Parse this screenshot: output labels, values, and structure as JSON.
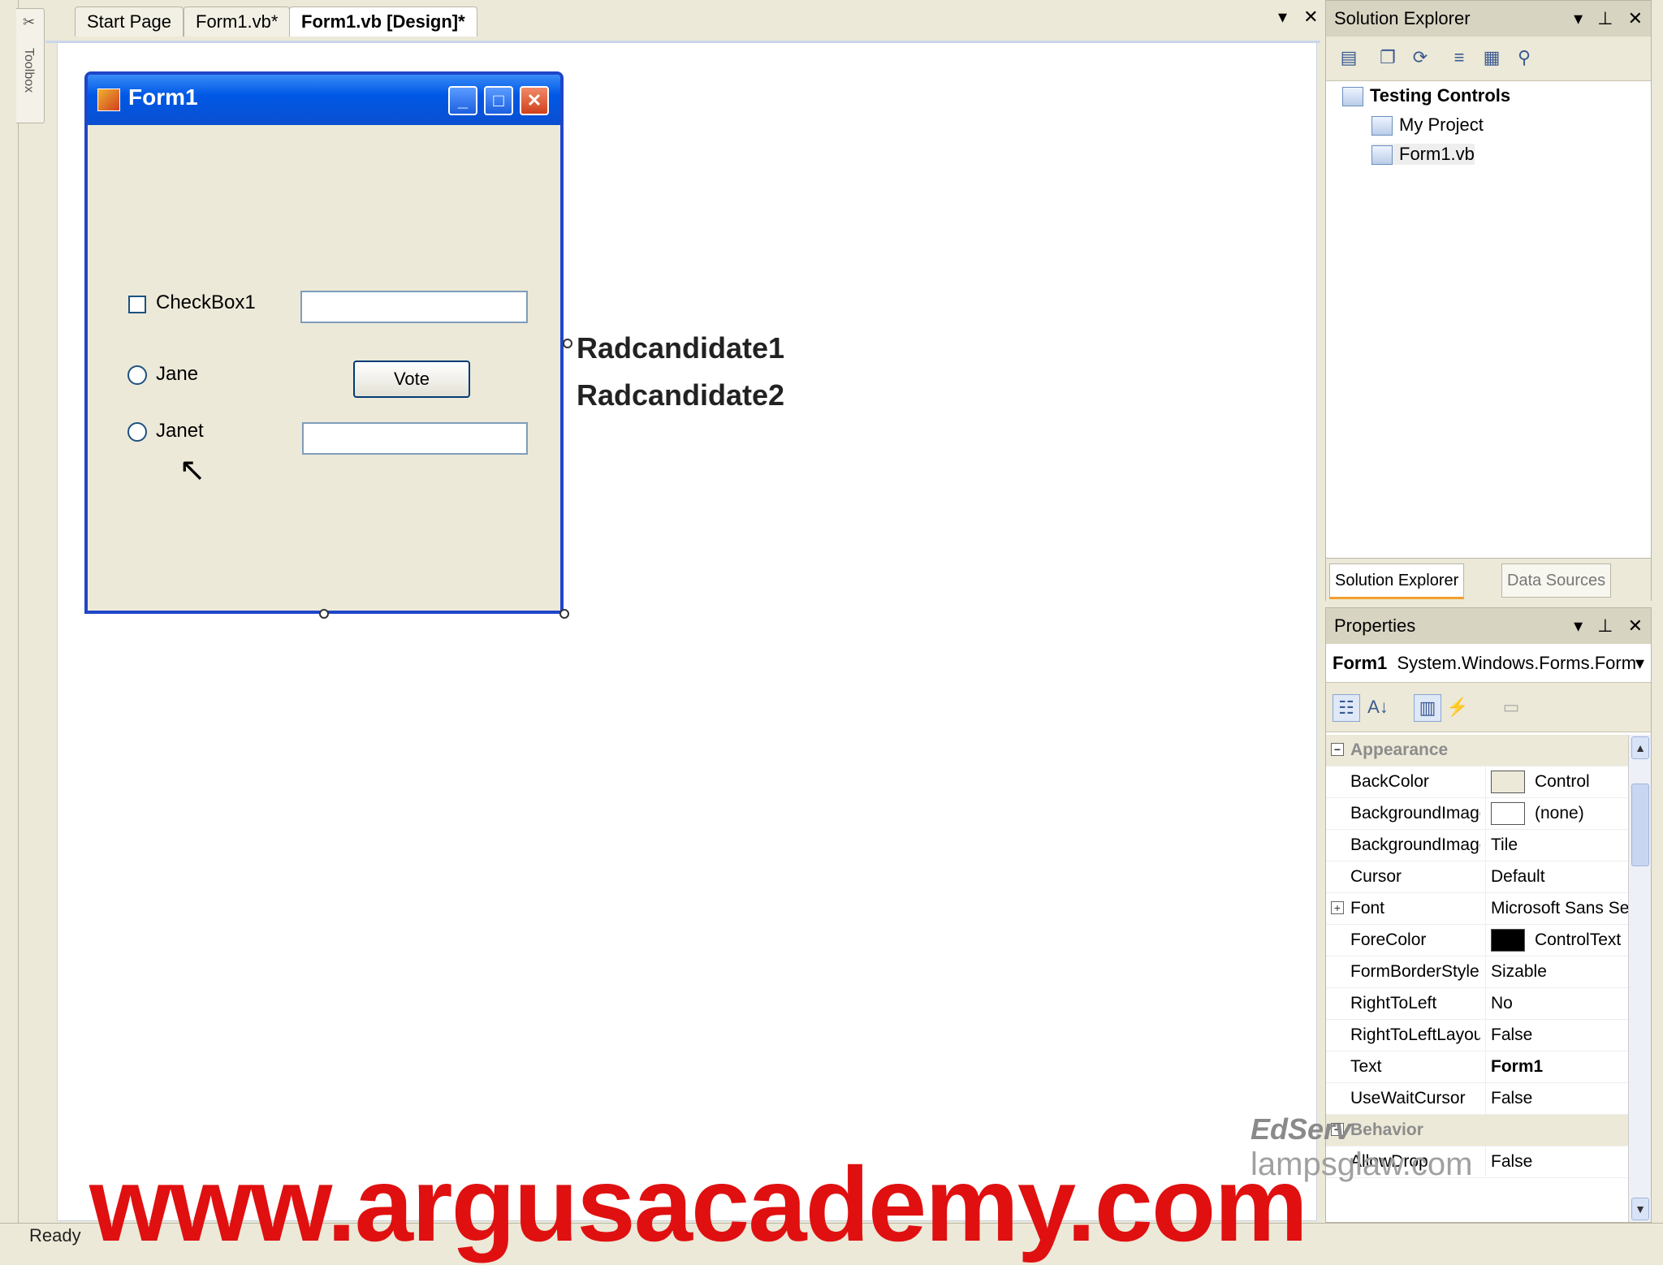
{
  "toolbox": {
    "label": "Toolbox"
  },
  "doc_tabs": [
    {
      "label": "Start Page"
    },
    {
      "label": "Form1.vb*"
    },
    {
      "label": "Form1.vb [Design]*"
    }
  ],
  "form": {
    "title": "Form1",
    "checkbox_label": "CheckBox1",
    "radio1_label": "Jane",
    "radio2_label": "Janet",
    "button_label": "Vote"
  },
  "overlay_labels": {
    "line1": "Radcandidate1",
    "line2": "Radcandidate2"
  },
  "solution_explorer": {
    "title": "Solution Explorer",
    "tree": {
      "root": "Testing Controls",
      "children": [
        "My Project",
        "Form1.vb"
      ]
    },
    "tabs": [
      "Solution Explorer",
      "Data Sources"
    ]
  },
  "properties": {
    "title": "Properties",
    "object_name": "Form1",
    "object_type": "System.Windows.Forms.Form",
    "categories": {
      "appearance": "Appearance",
      "behavior": "Behavior"
    },
    "rows": [
      {
        "name": "BackColor",
        "value": "Control",
        "swatch": "#ece9d8"
      },
      {
        "name": "BackgroundImage",
        "value": "(none)",
        "swatch": "#ffffff"
      },
      {
        "name": "BackgroundImageLayout",
        "value": "Tile"
      },
      {
        "name": "Cursor",
        "value": "Default"
      },
      {
        "name": "Font",
        "value": "Microsoft Sans Serif"
      },
      {
        "name": "ForeColor",
        "value": "ControlText",
        "swatch": "#000000"
      },
      {
        "name": "FormBorderStyle",
        "value": "Sizable"
      },
      {
        "name": "RightToLeft",
        "value": "No"
      },
      {
        "name": "RightToLeftLayout",
        "value": "False"
      },
      {
        "name": "Text",
        "value": "Form1"
      },
      {
        "name": "UseWaitCursor",
        "value": "False"
      }
    ],
    "behavior_rows": [
      {
        "name": "AllowDrop",
        "value": "False"
      }
    ]
  },
  "status": {
    "text": "Ready"
  },
  "watermarks": {
    "brand1": "EdServ",
    "brand2": "lampsglaw.com",
    "url": "www.argusacademy.com"
  }
}
